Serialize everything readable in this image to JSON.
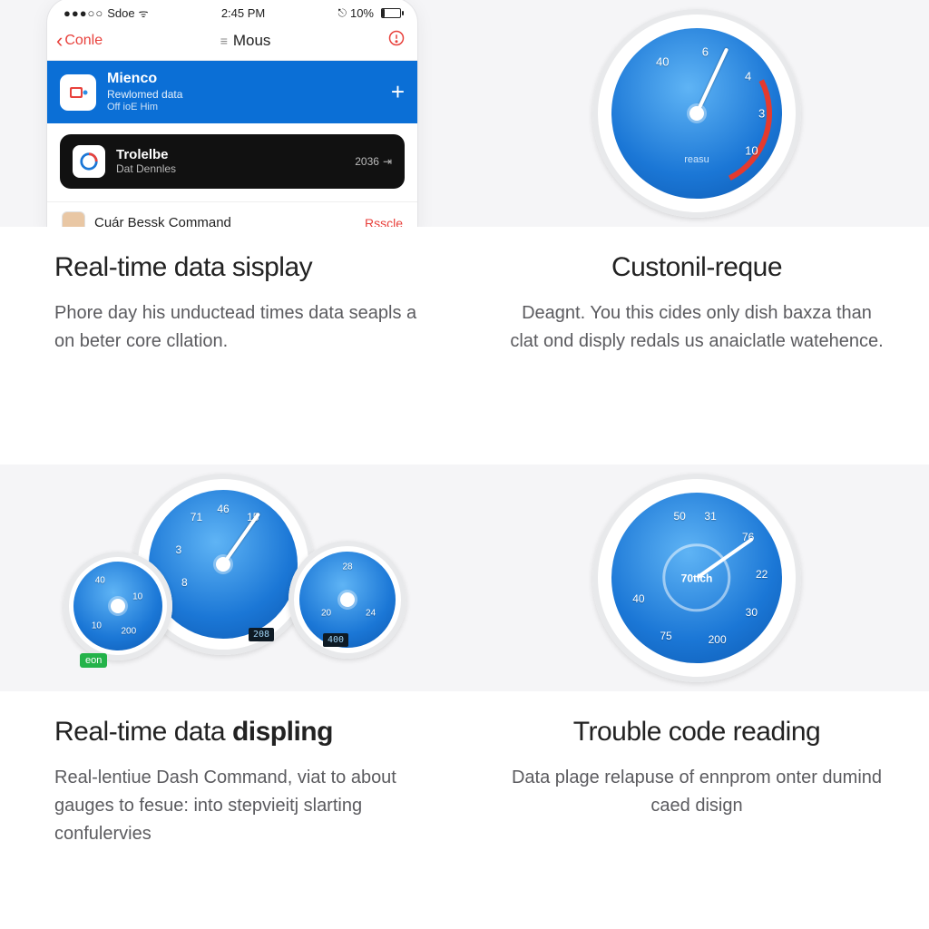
{
  "cells": [
    {
      "heading_plain": "Real-time data sisplay",
      "heading_bold": "",
      "body": "Phore day his unductead times data seapls a on beter core cllation.",
      "phone": {
        "status": {
          "carrier": "Sdoe",
          "time": "2:45 PM",
          "battery_text": "10%",
          "battery_pct": 10,
          "signal_dots": "●●●○○"
        },
        "nav": {
          "back": "Conle",
          "title": "Mous"
        },
        "banner": {
          "title": "Mienco",
          "subtitle": "Rewlomed data",
          "subtitle2": "Off ioE Him"
        },
        "dark_card": {
          "title": "Trolelbe",
          "subtitle": "Dat Dennles",
          "trail": "2036"
        },
        "contact": {
          "name": "Cuár Bessk Command",
          "action": "Rsscle"
        }
      }
    },
    {
      "heading_plain": "Custonil-reque",
      "heading_bold": "",
      "body": "Deagnt. You this cides only dish baxza than clat ond disply redals us anaiclatle watehence.",
      "gauge": {
        "numbers": [
          "40",
          "6",
          "4",
          "3",
          "10"
        ],
        "label": "reasu",
        "needle_deg": 25
      }
    },
    {
      "heading_plain": "Real-time data ",
      "heading_bold": "displing",
      "body": "Real-lentiue Dash Command, viat to about gauges to fesue: into stepvieitj slarting confulervies",
      "cluster": {
        "main": {
          "numbers": [
            "71",
            "46",
            "15",
            "3",
            "8"
          ],
          "needle_deg": 35
        },
        "left": {
          "numbers": [
            "40",
            "10",
            "200",
            "10"
          ]
        },
        "right": {
          "numbers": [
            "28",
            "20",
            "24"
          ],
          "lcd1": "208",
          "lcd2": "400"
        },
        "tag": "eon"
      }
    },
    {
      "heading_plain": "Trouble code reading",
      "heading_bold": "",
      "body": "Data plage relapuse of ennprom onter dumind caed disign",
      "gauge": {
        "numbers": [
          "50",
          "31",
          "76",
          "22",
          "30",
          "200",
          "75",
          "40"
        ],
        "center": "70tlch",
        "needle_deg": 55
      }
    }
  ]
}
